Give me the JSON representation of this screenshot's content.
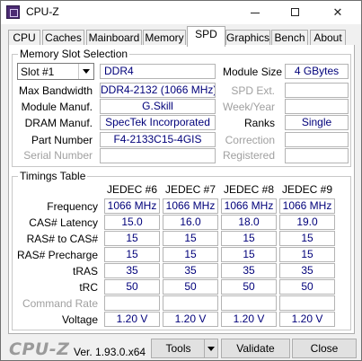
{
  "window": {
    "title": "CPU-Z",
    "close_glyph": "✕"
  },
  "tabs": [
    {
      "label": "CPU"
    },
    {
      "label": "Caches"
    },
    {
      "label": "Mainboard"
    },
    {
      "label": "Memory"
    },
    {
      "label": "SPD",
      "active": true
    },
    {
      "label": "Graphics"
    },
    {
      "label": "Bench"
    },
    {
      "label": "About"
    }
  ],
  "slot_section": {
    "title": "Memory Slot Selection",
    "slot_selected": "Slot #1",
    "memory_type": "DDR4",
    "module_size_label": "Module Size",
    "module_size": "4 GBytes",
    "max_bandwidth_label": "Max Bandwidth",
    "max_bandwidth": "DDR4-2132 (1066 MHz)",
    "spd_ext_label": "SPD Ext.",
    "spd_ext": "",
    "module_manuf_label": "Module Manuf.",
    "module_manuf": "G.Skill",
    "week_year_label": "Week/Year",
    "week_year": "",
    "dram_manuf_label": "DRAM Manuf.",
    "dram_manuf": "SpecTek Incorporated",
    "ranks_label": "Ranks",
    "ranks": "Single",
    "part_number_label": "Part Number",
    "part_number": "F4-2133C15-4GIS",
    "correction_label": "Correction",
    "correction": "",
    "serial_number_label": "Serial Number",
    "serial_number": "",
    "registered_label": "Registered",
    "registered": ""
  },
  "timings": {
    "title": "Timings Table",
    "columns": [
      "JEDEC #6",
      "JEDEC #7",
      "JEDEC #8",
      "JEDEC #9"
    ],
    "rows": [
      {
        "label": "Frequency",
        "values": [
          "1066 MHz",
          "1066 MHz",
          "1066 MHz",
          "1066 MHz"
        ]
      },
      {
        "label": "CAS# Latency",
        "values": [
          "15.0",
          "16.0",
          "18.0",
          "19.0"
        ]
      },
      {
        "label": "RAS# to CAS#",
        "values": [
          "15",
          "15",
          "15",
          "15"
        ]
      },
      {
        "label": "RAS# Precharge",
        "values": [
          "15",
          "15",
          "15",
          "15"
        ]
      },
      {
        "label": "tRAS",
        "values": [
          "35",
          "35",
          "35",
          "35"
        ]
      },
      {
        "label": "tRC",
        "values": [
          "50",
          "50",
          "50",
          "50"
        ]
      },
      {
        "label": "Command Rate",
        "values": [
          "",
          "",
          "",
          ""
        ],
        "disabled": true
      },
      {
        "label": "Voltage",
        "values": [
          "1.20 V",
          "1.20 V",
          "1.20 V",
          "1.20 V"
        ]
      }
    ]
  },
  "footer": {
    "logo": "CPU-Z",
    "version": "Ver. 1.93.0.x64",
    "tools_label": "Tools",
    "validate_label": "Validate",
    "close_label": "Close"
  }
}
